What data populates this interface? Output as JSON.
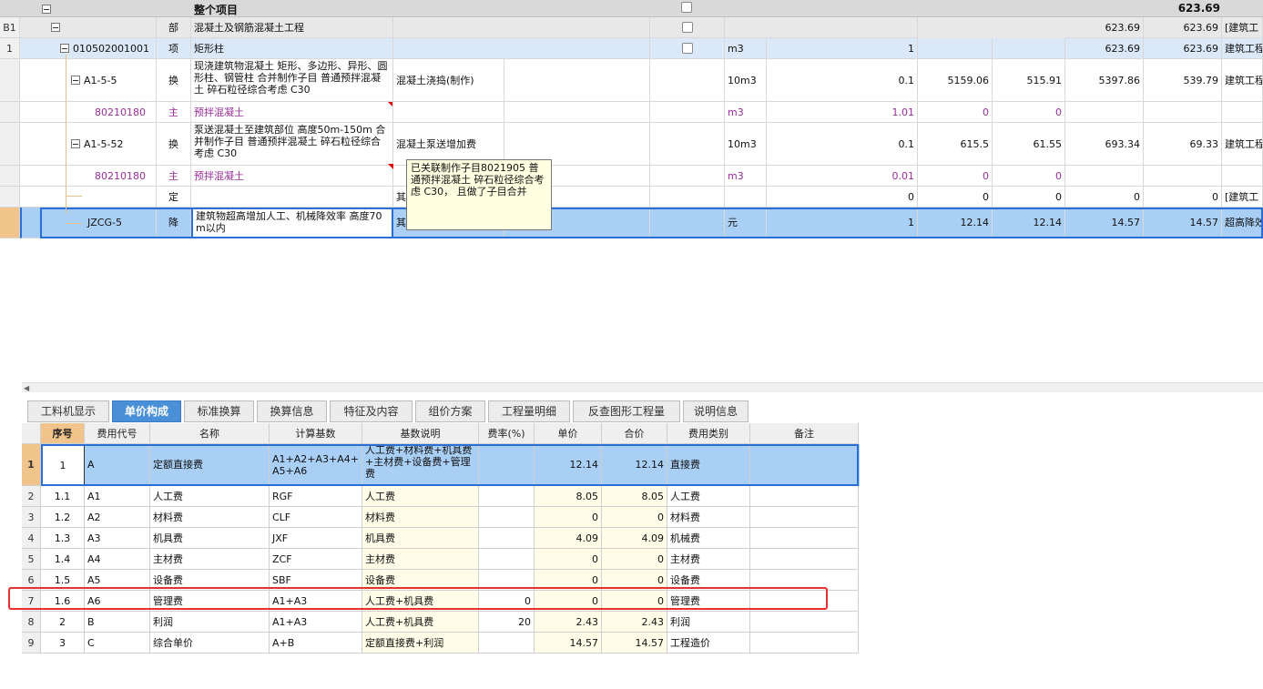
{
  "top_table": {
    "header": {
      "project_label": "整个项目",
      "total": "623.69"
    },
    "rows": [
      {
        "no": "B1",
        "code": "",
        "type": "部",
        "name": "混凝土及钢筋混凝土工程",
        "feature": "",
        "qty": "",
        "p1": "",
        "p2": "",
        "p3": "623.69",
        "p4": "623.69",
        "cat": "[建筑工"
      },
      {
        "no": "1",
        "code": "010502001001",
        "type": "项",
        "name": "矩形柱",
        "unit": "m3",
        "qty": "1",
        "p1": "",
        "p2": "",
        "p3": "623.69",
        "p4": "623.69",
        "cat": "建筑工程"
      },
      {
        "no": "",
        "code": "A1-5-5",
        "type": "换",
        "name": "现浇建筑物混凝土 矩形、多边形、异形、圆形柱、钢管柱  合并制作子目 普通预拌混凝土 碎石粒径综合考虑 C30",
        "feature": "混凝土浇捣(制作)",
        "unit": "10m3",
        "qty": "0.1",
        "p1": "5159.06",
        "p2": "515.91",
        "p3": "5397.86",
        "p4": "539.79",
        "cat": "建筑工程"
      },
      {
        "no": "",
        "code": "80210180",
        "type": "主",
        "name": "预拌混凝土",
        "unit": "m3",
        "qty": "1.01",
        "p1": "0",
        "p2": "0",
        "p3": "",
        "p4": "",
        "cat": ""
      },
      {
        "no": "",
        "code": "A1-5-52",
        "type": "换",
        "name": "泵送混凝土至建筑部位 高度50m-150m 合并制作子目 普通预拌混凝土 碎石粒径综合考虑 C30",
        "feature": "混凝土泵送增加费",
        "unit": "10m3",
        "qty": "0.1",
        "p1": "615.5",
        "p2": "61.55",
        "p3": "693.34",
        "p4": "69.33",
        "cat": "建筑工程"
      },
      {
        "no": "",
        "code": "80210180",
        "type": "主",
        "name": "预拌混凝土",
        "unit": "m3",
        "qty": "0.01",
        "p1": "0",
        "p2": "0",
        "p3": "",
        "p4": "",
        "cat": ""
      },
      {
        "no": "",
        "code": "",
        "type": "定",
        "name": "",
        "feature": "其",
        "unit": "",
        "qty": "0",
        "p1": "0",
        "p2": "0",
        "p3": "0",
        "p4": "0",
        "cat": "[建筑工"
      },
      {
        "no": "",
        "code": "JZCG-5",
        "type": "降",
        "name": "建筑物超高增加人工、机械降效率 高度70m以内",
        "feature": "其",
        "unit": "元",
        "qty": "1",
        "p1": "12.14",
        "p2": "12.14",
        "p3": "14.57",
        "p4": "14.57",
        "cat": "超高降效"
      }
    ],
    "tooltip": "已关联制作子目8021905 普通预拌混凝土 碎石粒径综合考虑 C30， 且做了子目合并"
  },
  "tabs": [
    "工料机显示",
    "单价构成",
    "标准换算",
    "换算信息",
    "特征及内容",
    "组价方案",
    "工程量明细",
    "反查图形工程量",
    "说明信息"
  ],
  "active_tab": "单价构成",
  "bottom_table": {
    "headers": [
      "序号",
      "费用代号",
      "名称",
      "计算基数",
      "基数说明",
      "费率(%)",
      "单价",
      "合价",
      "费用类别",
      "备注"
    ],
    "rows": [
      {
        "rn": "1",
        "seq": "1",
        "code": "A",
        "name": "定额直接费",
        "base": "A1+A2+A3+A4+A5+A6",
        "desc": "人工费+材料费+机具费+主材费+设备费+管理费",
        "rate": "",
        "price": "12.14",
        "total": "12.14",
        "type": "直接费",
        "note": ""
      },
      {
        "rn": "2",
        "seq": "1.1",
        "code": "A1",
        "name": "人工费",
        "base": "RGF",
        "desc": "人工费",
        "rate": "",
        "price": "8.05",
        "total": "8.05",
        "type": "人工费",
        "note": ""
      },
      {
        "rn": "3",
        "seq": "1.2",
        "code": "A2",
        "name": "材料费",
        "base": "CLF",
        "desc": "材料费",
        "rate": "",
        "price": "0",
        "total": "0",
        "type": "材料费",
        "note": ""
      },
      {
        "rn": "4",
        "seq": "1.3",
        "code": "A3",
        "name": "机具费",
        "base": "JXF",
        "desc": "机具费",
        "rate": "",
        "price": "4.09",
        "total": "4.09",
        "type": "机械费",
        "note": ""
      },
      {
        "rn": "5",
        "seq": "1.4",
        "code": "A4",
        "name": "主材费",
        "base": "ZCF",
        "desc": "主材费",
        "rate": "",
        "price": "0",
        "total": "0",
        "type": "主材费",
        "note": ""
      },
      {
        "rn": "6",
        "seq": "1.5",
        "code": "A5",
        "name": "设备费",
        "base": "SBF",
        "desc": "设备费",
        "rate": "",
        "price": "0",
        "total": "0",
        "type": "设备费",
        "note": ""
      },
      {
        "rn": "7",
        "seq": "1.6",
        "code": "A6",
        "name": "管理费",
        "base": "A1+A3",
        "desc": "人工费+机具费",
        "rate": "0",
        "price": "0",
        "total": "0",
        "type": "管理费",
        "note": ""
      },
      {
        "rn": "8",
        "seq": "2",
        "code": "B",
        "name": "利润",
        "base": "A1+A3",
        "desc": "人工费+机具费",
        "rate": "20",
        "price": "2.43",
        "total": "2.43",
        "type": "利润",
        "note": ""
      },
      {
        "rn": "9",
        "seq": "3",
        "code": "C",
        "name": "综合单价",
        "base": "A+B",
        "desc": "定额直接费+利润",
        "rate": "",
        "price": "14.57",
        "total": "14.57",
        "type": "工程造价",
        "note": ""
      }
    ]
  }
}
